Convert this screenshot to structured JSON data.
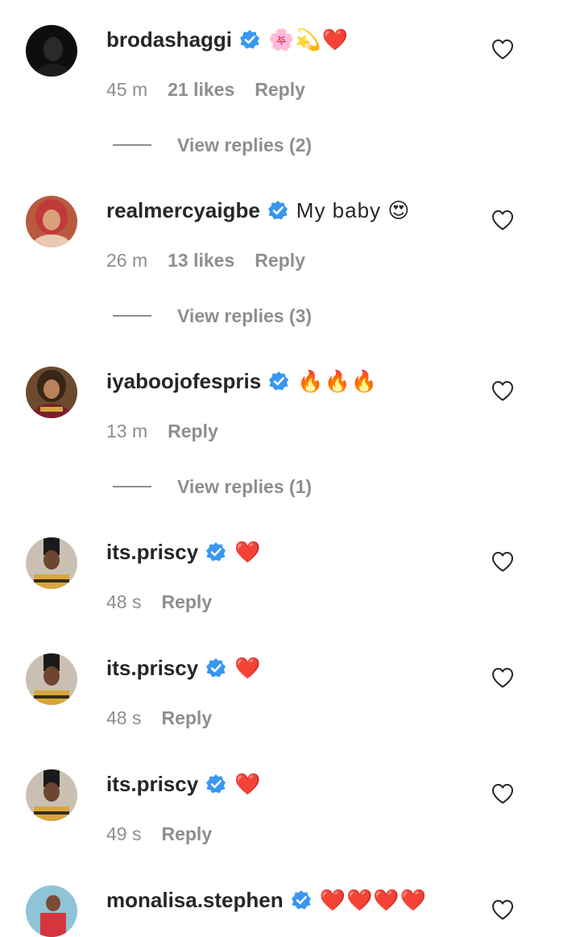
{
  "colors": {
    "text": "#262626",
    "secondary": "#8e8e8e",
    "verified": "#3897f0"
  },
  "comments": [
    {
      "username": "brodashaggi",
      "text": "🌸💫❤️",
      "time": "45 m",
      "likes": "21 likes",
      "reply": "Reply",
      "view_replies": "View replies (2)",
      "avatar_icon": "avatar-brodashaggi"
    },
    {
      "username": "realmercyaigbe",
      "text": "My baby 😍",
      "time": "26 m",
      "likes": "13 likes",
      "reply": "Reply",
      "view_replies": "View replies (3)",
      "avatar_icon": "avatar-realmercyaigbe"
    },
    {
      "username": "iyaboojofespris",
      "text": "🔥🔥🔥",
      "time": "13 m",
      "reply": "Reply",
      "view_replies": "View replies (1)",
      "avatar_icon": "avatar-iyaboojofespris"
    },
    {
      "username": "its.priscy",
      "text": "❤️",
      "time": "48 s",
      "reply": "Reply",
      "avatar_icon": "avatar-its-priscy"
    },
    {
      "username": "its.priscy",
      "text": "❤️",
      "time": "48 s",
      "reply": "Reply",
      "avatar_icon": "avatar-its-priscy"
    },
    {
      "username": "its.priscy",
      "text": "❤️",
      "time": "49 s",
      "reply": "Reply",
      "avatar_icon": "avatar-its-priscy"
    },
    {
      "username": "monalisa.stephen",
      "text": "❤️❤️❤️❤️",
      "avatar_icon": "avatar-monalisa-stephen"
    }
  ]
}
